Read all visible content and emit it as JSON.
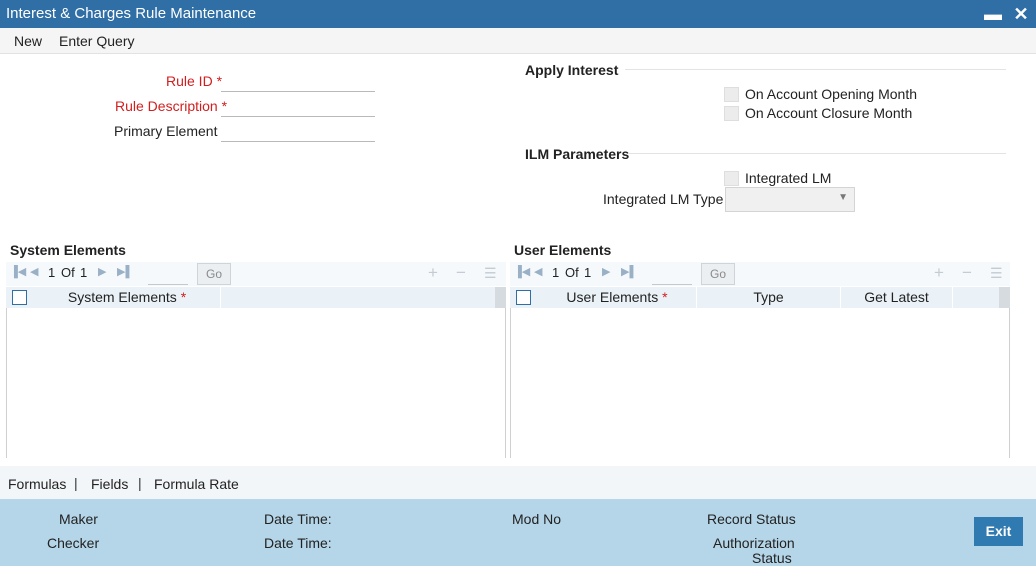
{
  "window": {
    "title": "Interest & Charges Rule Maintenance",
    "minimize_glyph": "▬",
    "close_glyph": "✕"
  },
  "menu": {
    "new": "New",
    "enter_query": "Enter Query"
  },
  "form": {
    "rule_id_label": "Rule ID",
    "rule_description_label": "Rule Description",
    "primary_element_label": "Primary Element",
    "required_marker": "*",
    "rule_id_value": "",
    "rule_description_value": "",
    "primary_element_value": ""
  },
  "apply_interest": {
    "heading": "Apply Interest",
    "opening_month_label": "On Account Opening Month",
    "closure_month_label": "On Account Closure Month"
  },
  "ilm": {
    "heading": "ILM Parameters",
    "integrated_lm_label": "Integrated LM",
    "integrated_lm_type_label": "Integrated LM Type",
    "integrated_lm_type_value": ""
  },
  "system_elements": {
    "title": "System Elements",
    "page_current": "1",
    "page_of": "Of",
    "page_total": "1",
    "go_label": "Go",
    "columns": [
      "System Elements"
    ]
  },
  "user_elements": {
    "title": "User Elements",
    "page_current": "1",
    "page_of": "Of",
    "page_total": "1",
    "go_label": "Go",
    "columns": [
      "User Elements",
      "Type",
      "Get Latest"
    ]
  },
  "tabs": {
    "formulas": "Formulas",
    "fields": "Fields",
    "formula_rate": "Formula Rate",
    "separator": "|"
  },
  "footer": {
    "maker": "Maker",
    "checker": "Checker",
    "date_time": "Date Time:",
    "mod_no": "Mod No",
    "record_status": "Record Status",
    "authorization_status_line1": "Authorization",
    "authorization_status_line2": "Status",
    "exit": "Exit"
  },
  "icons": {
    "first": "first-page-icon",
    "prev": "previous-page-icon",
    "next": "next-page-icon",
    "last": "last-page-icon",
    "add": "add-row-icon",
    "delete": "delete-row-icon",
    "view": "single-view-icon"
  }
}
